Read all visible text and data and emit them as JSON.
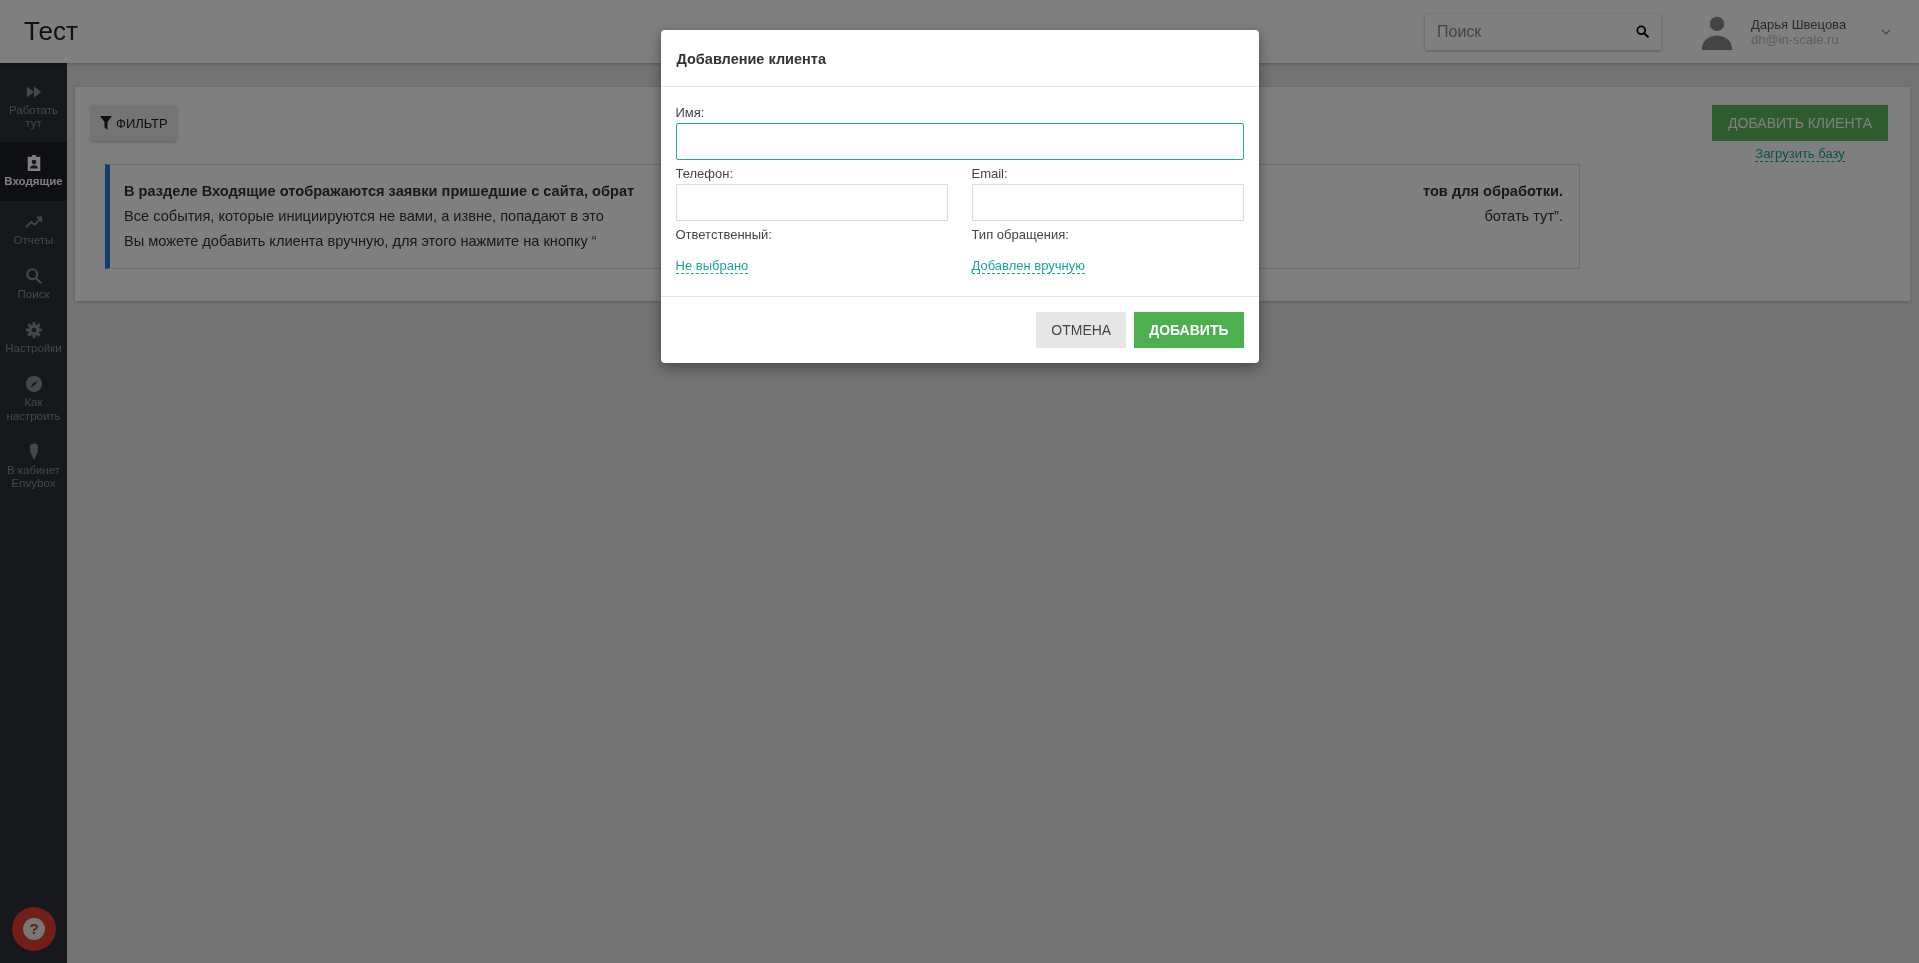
{
  "header": {
    "title": "Тест",
    "search": {
      "placeholder": "Поиск"
    },
    "user": {
      "name": "Дарья Швецова",
      "email": "dh@in-scale.ru"
    }
  },
  "sidebar": {
    "items": [
      {
        "kind": "forward",
        "label": "Работать тут",
        "selected": false
      },
      {
        "kind": "badge",
        "label": "Входящие",
        "selected": true
      },
      {
        "kind": "trend",
        "label": "Отчеты",
        "selected": false
      },
      {
        "kind": "search",
        "label": "Поиск",
        "selected": false
      },
      {
        "kind": "gear",
        "label": "Настройки",
        "selected": false
      },
      {
        "kind": "compass",
        "label": "Как настроить",
        "selected": false
      },
      {
        "kind": "cone",
        "label": "В кабинет Envybox",
        "selected": false
      }
    ],
    "help": "?"
  },
  "toolbar": {
    "filter": "ФИЛЬТР",
    "add_client": "ДОБАВИТЬ КЛИЕНТА",
    "upload": "Загрузить базу"
  },
  "info": {
    "lines": [
      {
        "left": "В разделе Входящие отображаются заявки пришедшие с сайта, обрат",
        "right": "тов для обработки.",
        "bold": true
      },
      {
        "left": "Все события, которые инициируются не вами, а извне, попадают в это",
        "right": "ботать тут”.",
        "bold": false
      },
      {
        "left": "Вы можете добавить клиента вручную, для этого нажмите на кнопку “",
        "bold": false
      }
    ]
  },
  "dialog": {
    "title": "Добавление клиента",
    "name_label": "Имя:",
    "phone_label": "Телефон:",
    "email_label": "Email:",
    "owner_label": "Ответственный:",
    "owner_value": "Не выбрано",
    "type_label": "Тип обращения:",
    "type_value": "Добавлен вручную",
    "buttons": {
      "cancel": "ОТМЕНА",
      "add": "ДОБАВИТЬ"
    }
  }
}
